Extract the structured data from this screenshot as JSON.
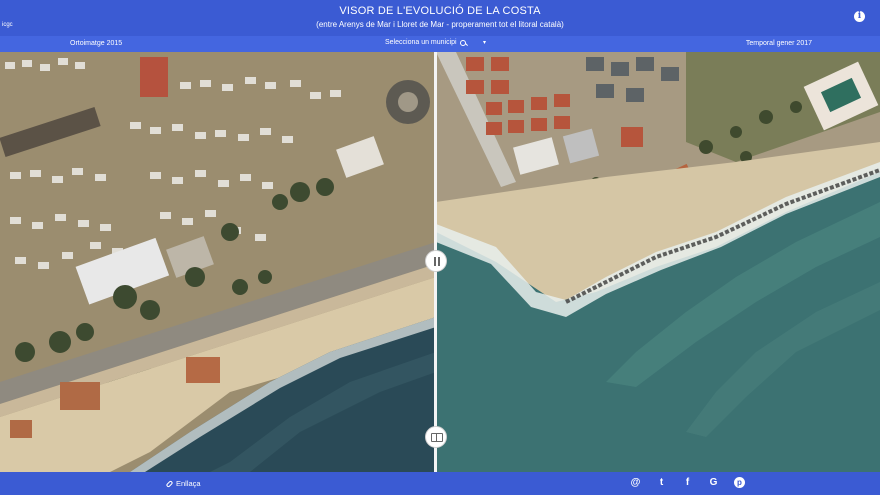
{
  "header": {
    "logo_text": "icgc",
    "title": "VISOR DE L'EVOLUCIÓ DE LA COSTA",
    "subtitle": "(entre Arenys de Mar i Lloret de Mar - properament tot el litoral català)",
    "info_icon": "i"
  },
  "subbar": {
    "left_label": "Ortoimatge 2015",
    "select_label": "Selecciona un municipi",
    "right_label": "Temporal gener 2017",
    "caret": "▾"
  },
  "footer": {
    "link_label": "Enllaça",
    "social": [
      {
        "name": "email",
        "glyph": "@"
      },
      {
        "name": "twitter",
        "glyph": "t"
      },
      {
        "name": "facebook",
        "glyph": "f"
      },
      {
        "name": "google",
        "glyph": "G"
      },
      {
        "name": "pinterest",
        "glyph": "p"
      }
    ]
  },
  "colors": {
    "header": "#3b5bd3",
    "subbar": "#4466e0",
    "sea_left": "#2a4a57",
    "sea_right": "#3c7272",
    "sand": "#d9c9a7"
  }
}
